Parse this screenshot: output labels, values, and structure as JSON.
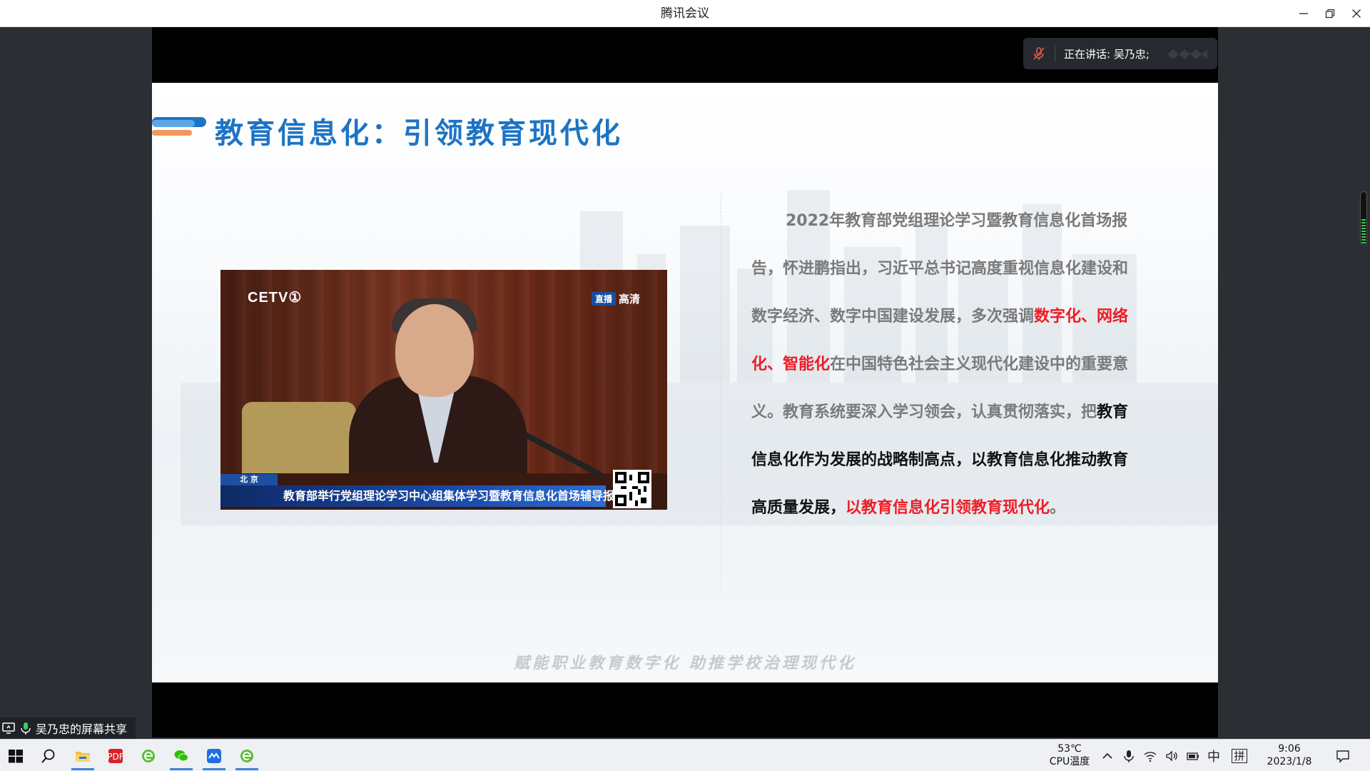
{
  "window": {
    "title": "腾讯会议"
  },
  "speaker": {
    "label": "正在讲话: 吴乃忠;"
  },
  "slide": {
    "title": "教育信息化：引领教育现代化",
    "paragraph": {
      "p1": "2022年教育部党组理论学习暨教育信息化首场报告，怀进鹏指出，习近平总书记高度重视信息化建设和数字经济、数字中国建设发展，多次强调",
      "p2_red": "数字化、网络化、智能化",
      "p3": "在中国特色社会主义现代化建设中的重要意义。教育系统要深入学习领会，认真贯彻落实，把",
      "p4_black": "教育信息化作为发展的战略制高点，以教育信息化推动教育高质量发展，",
      "p5_red": "以教育信息化引领教育现代化",
      "p6": "。"
    },
    "footer": "赋能职业教育数字化 助推学校治理现代化",
    "tv": {
      "logo": "CETV①",
      "live_tag": "直播",
      "hd": "高清",
      "location": "北 京",
      "ticker": "教育部举行党组理论学习中心组集体学习暨教育信息化首场辅导报告会"
    }
  },
  "share_banner": {
    "label": "吴乃忠的屏幕共享"
  },
  "taskbar": {
    "temperature": "53℃",
    "temperature_label": "CPU温度",
    "ime_lang": "中",
    "ime_mode": "拼",
    "time": "9:06",
    "date": "2023/1/8"
  },
  "colors": {
    "title_blue": "#1d74c4",
    "highlight_red": "#ee1c25",
    "body_gray": "#7a7a7a"
  }
}
